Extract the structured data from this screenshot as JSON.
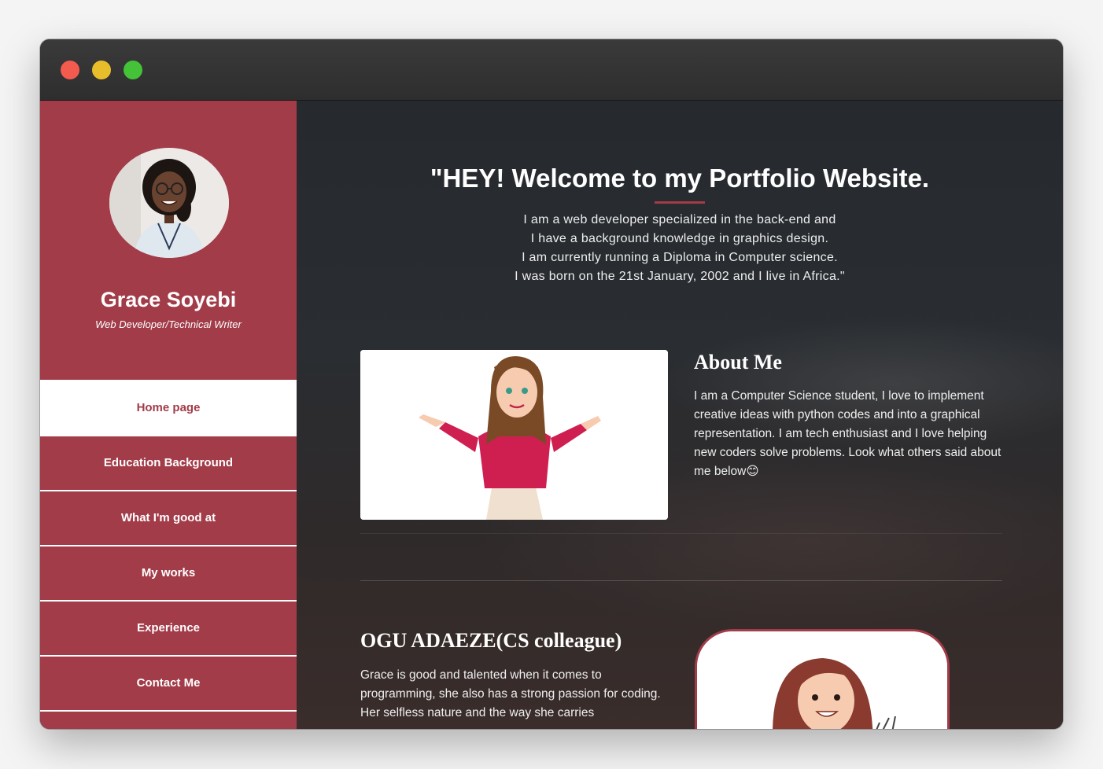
{
  "sidebar": {
    "name": "Grace Soyebi",
    "role": "Web Developer/Technical Writer",
    "nav": [
      {
        "label": "Home page",
        "active": true
      },
      {
        "label": "Education Background",
        "active": false
      },
      {
        "label": "What I'm good at",
        "active": false
      },
      {
        "label": "My works",
        "active": false
      },
      {
        "label": "Experience",
        "active": false
      },
      {
        "label": "Contact Me",
        "active": false
      }
    ]
  },
  "hero": {
    "title": "\"HEY! Welcome to my Portfolio Website.",
    "lines": [
      "I am a web developer specialized in the back-end and",
      "I have a background knowledge in graphics design.",
      "I am currently running a Diploma in Computer science.",
      "I was born on the 21st January, 2002 and I live in Africa.\""
    ]
  },
  "about": {
    "title": "About Me",
    "text": "I am a Computer Science student, I love to implement creative ideas with python codes and into a graphical representation. I am tech enthusiast and I love helping new coders solve problems. Look what others said about me below😊"
  },
  "testimonial": {
    "title": "OGU ADAEZE(CS colleague)",
    "text": "Grace is good and talented when it comes to programming, she also has a strong passion for coding. Her selfless nature and the way she carries"
  },
  "colors": {
    "accent": "#a23c49",
    "background": "#262a2f",
    "titlebar": "#333333"
  }
}
